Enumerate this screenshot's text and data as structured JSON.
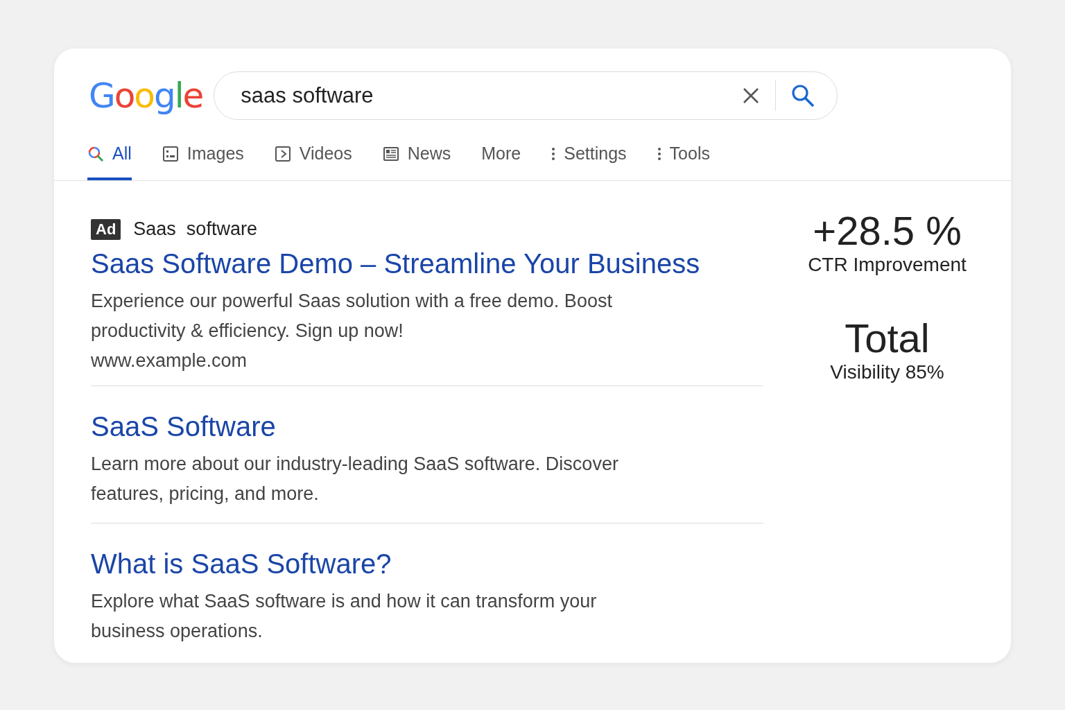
{
  "logo": "Google",
  "search": {
    "value": "saas software"
  },
  "tabs": [
    {
      "label": "All",
      "kind": "search",
      "selected": true
    },
    {
      "label": "Images",
      "kind": "image",
      "selected": false
    },
    {
      "label": "Videos",
      "kind": "video",
      "selected": false
    },
    {
      "label": "News",
      "kind": "news",
      "selected": false
    },
    {
      "label": "More",
      "kind": "plain",
      "selected": false
    },
    {
      "label": "Settings",
      "kind": "menu",
      "selected": false
    },
    {
      "label": "Tools",
      "kind": "menu",
      "selected": false
    }
  ],
  "results": [
    {
      "kind": "ad",
      "badge": "Ad",
      "advertiser": "Saas  software",
      "title": "Saas Software Demo – Streamline Your Business",
      "snippet": "Experience our powerful Saas solution with a free demo. Boost productivity & efficiency. Sign up now!",
      "url": "www.example.com"
    },
    {
      "kind": "organic",
      "title": "SaaS Software",
      "snippet": "Learn more about our industry-leading SaaS software. Discover features, pricing, and more."
    },
    {
      "kind": "organic",
      "title": "What is SaaS Software?",
      "snippet": "Explore what SaaS software is and how it can transform your business operations."
    }
  ],
  "stats": [
    {
      "value": "+28.5 %",
      "label": "CTR Improvement"
    },
    {
      "value": "Total",
      "label": "Visibility 85%"
    }
  ]
}
